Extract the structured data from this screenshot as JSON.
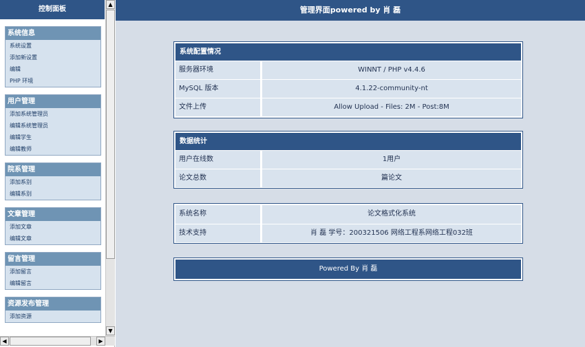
{
  "left_title": "控制面板",
  "menu": [
    {
      "header": "系统信息",
      "items": [
        "系统设置",
        "添加新设置",
        "编辑",
        "PHP 环境"
      ]
    },
    {
      "header": "用户管理",
      "items": [
        "添加系统管理员",
        "编辑系统管理员",
        "编辑学生",
        "编辑教师"
      ]
    },
    {
      "header": "院系管理",
      "items": [
        "添加系别",
        "编辑系别"
      ]
    },
    {
      "header": "文章管理",
      "items": [
        "添加文章",
        "编辑文章"
      ]
    },
    {
      "header": "留言管理",
      "items": [
        "添加留言",
        "编辑留言"
      ]
    },
    {
      "header": "资源发布管理",
      "items": [
        "添加资源"
      ]
    }
  ],
  "scrollbars": {
    "up": "▲",
    "down": "▼",
    "left": "◀",
    "right": "▶"
  },
  "main_title": "管理界面powered by 肖 磊",
  "config_panel": {
    "title": "系统配置情况",
    "rows": [
      {
        "label": "服务器环境",
        "value": "WINNT / PHP v4.4.6"
      },
      {
        "label": "MySQL 版本",
        "value": "4.1.22-community-nt"
      },
      {
        "label": "文件上传",
        "value": "Allow Upload - Files: 2M - Post:8M"
      }
    ]
  },
  "stats_panel": {
    "title": "数据统计",
    "rows": [
      {
        "label": "用户在线数",
        "value": "1用户"
      },
      {
        "label": "论文总数",
        "value": "篇论文"
      }
    ]
  },
  "info_panel": {
    "rows": [
      {
        "label": "系统名称",
        "value": "论文格式化系统"
      },
      {
        "label": "技术支持",
        "value": "肖 磊 学号：200321506 网络工程系网络工程032班"
      }
    ]
  },
  "footer": {
    "text": "Powered By 肖 磊"
  }
}
